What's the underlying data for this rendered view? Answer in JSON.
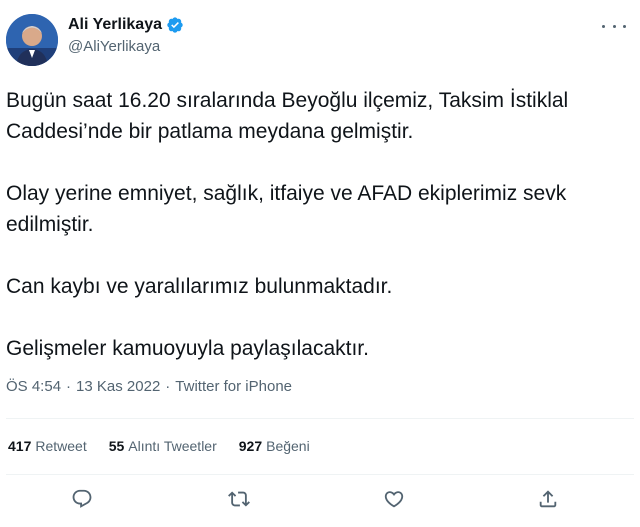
{
  "author": {
    "display_name": "Ali Yerlikaya",
    "handle": "@AliYerlikaya",
    "verified": true
  },
  "more_icon": "more-dots-icon",
  "tweet": {
    "paragraphs": [
      "Bugün saat 16.20 sıralarında Beyoğlu ilçemiz, Taksim İstiklal Caddesi’nde bir patlama meydana gelmiştir.",
      "Olay yerine emniyet, sağlık, itfaiye ve AFAD ekiplerimiz sevk edilmiştir.",
      "Can kaybı ve yaralılarımız bulunmaktadır.",
      "Gelişmeler kamuoyuyla paylaşılacaktır."
    ]
  },
  "meta": {
    "time": "ÖS 4:54",
    "separator": "·",
    "date": "13 Kas 2022",
    "source": "Twitter for iPhone"
  },
  "stats": {
    "retweets_count": "417",
    "retweets_label": "Retweet",
    "quotes_count": "55",
    "quotes_label": "Alıntı Tweetler",
    "likes_count": "927",
    "likes_label": "Beğeni"
  },
  "actions": [
    "reply-icon",
    "retweet-icon",
    "like-icon",
    "share-icon"
  ],
  "colors": {
    "text": "#0f1419",
    "secondary": "#536471",
    "verified": "#1d9bf0",
    "divider": "#eff3f4"
  }
}
